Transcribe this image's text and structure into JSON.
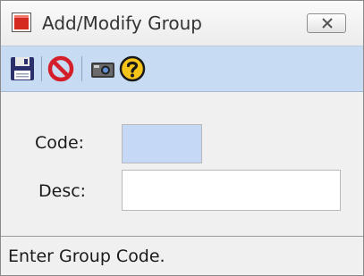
{
  "window": {
    "title": "Add/Modify Group"
  },
  "toolbar": {
    "buttons": [
      {
        "name": "save",
        "icon": "floppy-disk-icon"
      },
      {
        "name": "cancel",
        "icon": "no-entry-icon"
      },
      {
        "name": "lookup",
        "icon": "camera-icon"
      },
      {
        "name": "help",
        "icon": "question-mark-icon"
      }
    ]
  },
  "form": {
    "code": {
      "label": "Code:",
      "value": ""
    },
    "desc": {
      "label": "Desc:",
      "value": ""
    }
  },
  "status": {
    "text": "Enter Group Code."
  },
  "colors": {
    "toolbar_bg": "#c7dcf3",
    "focused_field_bg": "#c5d8f5",
    "app_icon_red": "#d42a1f"
  }
}
